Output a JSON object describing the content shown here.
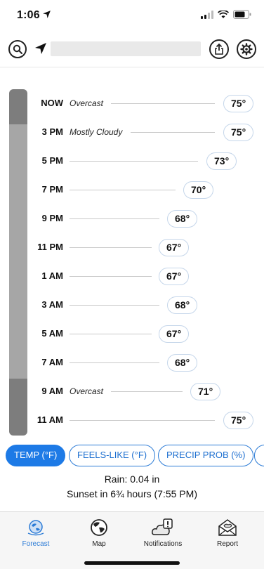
{
  "status_bar": {
    "time": "1:06"
  },
  "header": {
    "search_icon": "search-icon",
    "location_icon": "location-arrow-icon",
    "share_icon": "share-icon",
    "settings_icon": "gear-icon"
  },
  "forecast": {
    "rows": [
      {
        "time": "NOW",
        "condition": "Overcast",
        "temp": "75°"
      },
      {
        "time": "3 PM",
        "condition": "Mostly Cloudy",
        "temp": "75°"
      },
      {
        "time": "5 PM",
        "condition": "",
        "temp": "73°"
      },
      {
        "time": "7 PM",
        "condition": "",
        "temp": "70°"
      },
      {
        "time": "9 PM",
        "condition": "",
        "temp": "68°"
      },
      {
        "time": "11 PM",
        "condition": "",
        "temp": "67°"
      },
      {
        "time": "1 AM",
        "condition": "",
        "temp": "67°"
      },
      {
        "time": "3 AM",
        "condition": "",
        "temp": "68°"
      },
      {
        "time": "5 AM",
        "condition": "",
        "temp": "67°"
      },
      {
        "time": "7 AM",
        "condition": "",
        "temp": "68°"
      },
      {
        "time": "9 AM",
        "condition": "Overcast",
        "temp": "71°"
      },
      {
        "time": "11 AM",
        "condition": "",
        "temp": "75°"
      }
    ]
  },
  "chips": [
    {
      "label": "TEMP (°F)",
      "active": true
    },
    {
      "label": "FEELS-LIKE (°F)",
      "active": false
    },
    {
      "label": "PRECIP PROB (%)",
      "active": false
    }
  ],
  "info": {
    "rain": "Rain: 0.04 in",
    "sunset": "Sunset in 6¾ hours (7:55 PM)"
  },
  "tabbar": {
    "tabs": [
      {
        "label": "Forecast",
        "icon": "forecast-globe-icon",
        "active": true
      },
      {
        "label": "Map",
        "icon": "globe-icon",
        "active": false
      },
      {
        "label": "Notifications",
        "icon": "cloud-alert-icon",
        "active": false
      },
      {
        "label": "Report",
        "icon": "envelope-icon",
        "active": false
      }
    ]
  },
  "colors": {
    "accent": "#1d7ae6",
    "sky_overcast": "#7d7d7d",
    "sky_cloudy": "#a6a6a6"
  }
}
